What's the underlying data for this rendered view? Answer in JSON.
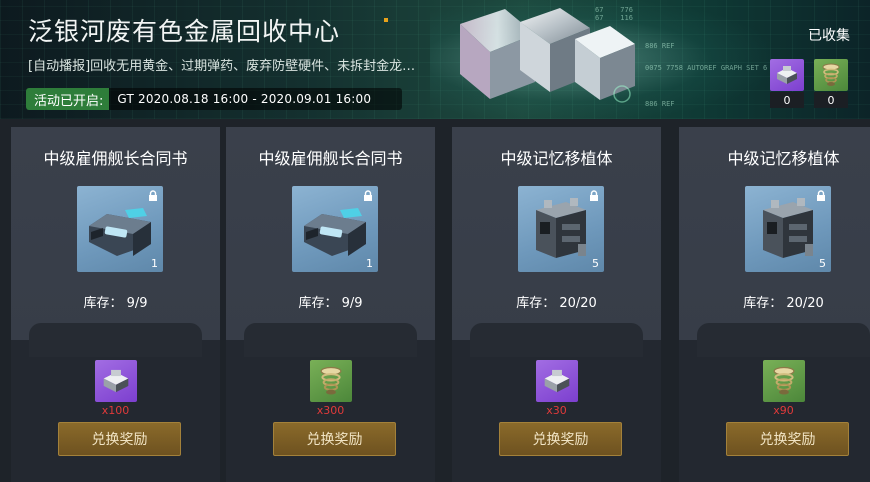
{
  "banner": {
    "title": "泛银河废有色金属回收中心",
    "description": "[自动播报]回收无用黄金、过期弹药、废弃防壁硬件、未拆封金龙…",
    "event_label": "活动已开启:",
    "event_time": "GT 2020.08.18 16:00 - 2020.09.01 16:00",
    "collected_label": "已收集",
    "collected": [
      {
        "icon": "metal-scrap-icon",
        "count": "0",
        "color": "#8a4fd6"
      },
      {
        "icon": "coil-spring-icon",
        "count": "0",
        "color": "#5a9643"
      }
    ]
  },
  "cards": [
    {
      "title": "中级雇佣舰长合同书",
      "item_icon": "contract-device-icon",
      "qty": "1",
      "stock_label": "库存：",
      "stock": "9/9",
      "cost_icon": "metal-scrap-icon",
      "cost_tile": "purple",
      "cost": "x100",
      "button": "兑换奖励"
    },
    {
      "title": "中级雇佣舰长合同书",
      "item_icon": "contract-device-icon",
      "qty": "1",
      "stock_label": "库存：",
      "stock": "9/9",
      "cost_icon": "coil-spring-icon",
      "cost_tile": "green",
      "cost": "x300",
      "button": "兑换奖励"
    },
    {
      "title": "中级记忆移植体",
      "item_icon": "memory-implant-icon",
      "qty": "5",
      "stock_label": "库存：",
      "stock": "20/20",
      "cost_icon": "metal-scrap-icon",
      "cost_tile": "purple",
      "cost": "x30",
      "button": "兑换奖励"
    },
    {
      "title": "中级记忆移植体",
      "item_icon": "memory-implant-icon",
      "qty": "5",
      "stock_label": "库存：",
      "stock": "20/20",
      "cost_icon": "coil-spring-icon",
      "cost_tile": "green",
      "cost": "x90",
      "button": "兑换奖励"
    }
  ]
}
